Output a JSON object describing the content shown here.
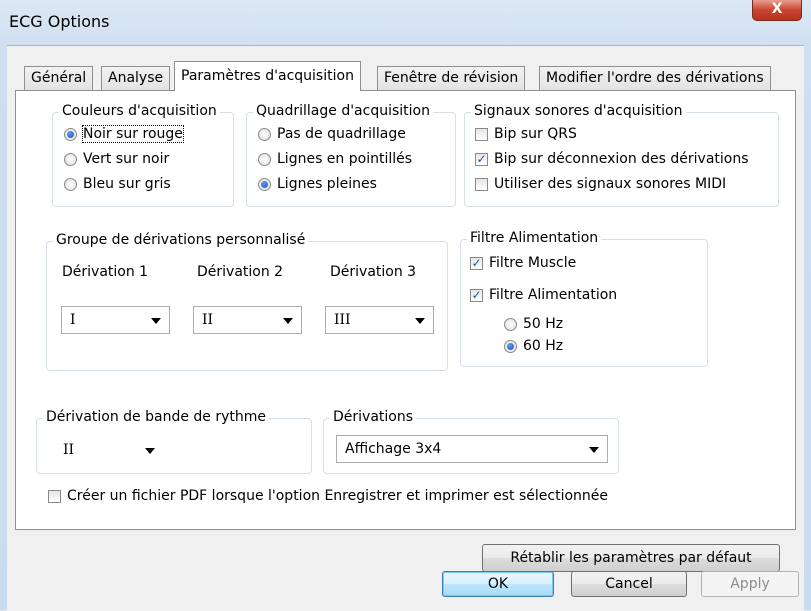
{
  "window": {
    "title": "ECG Options",
    "close_label": "X"
  },
  "tabs": [
    {
      "label": "Général",
      "active": false
    },
    {
      "label": "Analyse",
      "active": false
    },
    {
      "label": "Paramètres d'acquisition",
      "active": true
    },
    {
      "label": "Fenêtre de révision",
      "active": false
    },
    {
      "label": "Modifier l'ordre des dérivations",
      "active": false
    }
  ],
  "colors_group": {
    "legend": "Couleurs d'acquisition",
    "options": [
      {
        "label": "Noir sur rouge",
        "selected": true
      },
      {
        "label": "Vert sur noir",
        "selected": false
      },
      {
        "label": "Bleu sur gris",
        "selected": false
      }
    ]
  },
  "grid_group": {
    "legend": "Quadrillage d'acquisition",
    "options": [
      {
        "label": "Pas de quadrillage",
        "selected": false
      },
      {
        "label": "Lignes en pointillés",
        "selected": false
      },
      {
        "label": "Lignes pleines",
        "selected": true
      }
    ]
  },
  "sound_group": {
    "legend": "Signaux sonores d'acquisition",
    "options": [
      {
        "label": "Bip sur QRS",
        "checked": false
      },
      {
        "label": "Bip sur déconnexion des dérivations",
        "checked": true
      },
      {
        "label": "Utiliser des signaux sonores MIDI",
        "checked": false
      }
    ]
  },
  "custom_leads_group": {
    "legend": "Groupe de dérivations personnalisé",
    "leads": [
      {
        "label": "Dérivation 1",
        "value": "I"
      },
      {
        "label": "Dérivation 2",
        "value": "II"
      },
      {
        "label": "Dérivation 3",
        "value": "III"
      }
    ]
  },
  "power_filter_group": {
    "legend": "Filtre Alimentation",
    "muscle_filter": {
      "label": "Filtre Muscle",
      "checked": true
    },
    "power_filter": {
      "label": "Filtre Alimentation",
      "checked": true
    },
    "frequencies": [
      {
        "label": "50 Hz",
        "selected": false
      },
      {
        "label": "60 Hz",
        "selected": true
      }
    ]
  },
  "rhythm_group": {
    "legend": "Dérivation de bande de rythme",
    "value": "II"
  },
  "leads_group": {
    "legend": "Dérivations",
    "value": "Affichage 3x4"
  },
  "pdf_option": {
    "label": "Créer un fichier PDF lorsque l'option Enregistrer et imprimer est sélectionnée",
    "checked": false
  },
  "buttons": {
    "reset": "Rétablir les paramètres par défaut",
    "ok": "OK",
    "cancel": "Cancel",
    "apply": "Apply"
  },
  "colors": {
    "check_mark": "#2b4f9a",
    "radio_dot": "#1c4fb0",
    "close_button": "#c7452f"
  }
}
